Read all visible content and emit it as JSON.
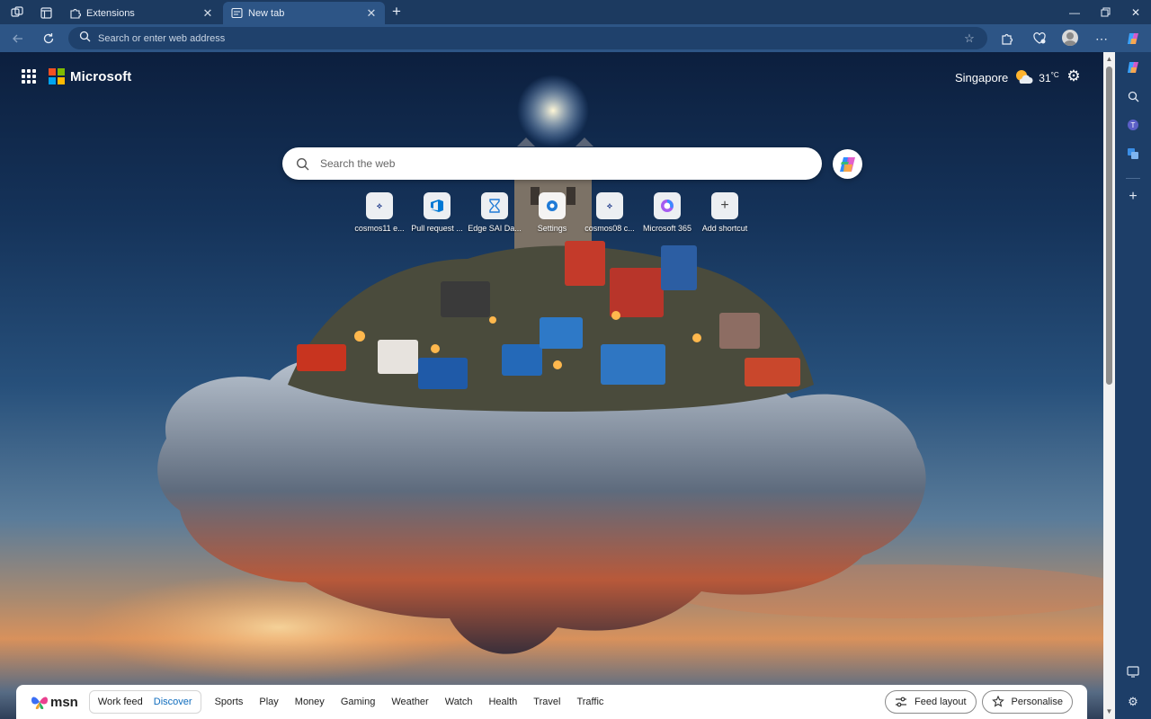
{
  "tabs": [
    {
      "label": "Extensions",
      "icon": "puzzle-icon"
    },
    {
      "label": "New tab",
      "icon": "newtab-icon"
    }
  ],
  "address_bar": {
    "placeholder": "Search or enter web address"
  },
  "page": {
    "brand": "Microsoft",
    "weather": {
      "city": "Singapore",
      "temperature": "31",
      "unit": "°C"
    },
    "search": {
      "placeholder": "Search the web"
    },
    "shortcuts": [
      {
        "label": "cosmos11 e...",
        "icon": "cosmos-icon",
        "abbr": "⟡"
      },
      {
        "label": "Pull request ...",
        "icon": "azure-devops-icon",
        "abbr": ""
      },
      {
        "label": "Edge SAI Da...",
        "icon": "hourglass-icon",
        "abbr": "⧖"
      },
      {
        "label": "Settings",
        "icon": "settings-dot-icon",
        "abbr": ""
      },
      {
        "label": "cosmos08 c...",
        "icon": "cosmos-icon",
        "abbr": "⟡"
      },
      {
        "label": "Microsoft 365",
        "icon": "m365-icon",
        "abbr": ""
      },
      {
        "label": "Add shortcut",
        "icon": "plus-icon",
        "abbr": "+"
      }
    ]
  },
  "msn": {
    "logo": "msn",
    "feed_tabs": [
      "Work feed",
      "Discover"
    ],
    "selected_feed": "Discover",
    "nav": [
      "Sports",
      "Play",
      "Money",
      "Gaming",
      "Weather",
      "Watch",
      "Health",
      "Travel",
      "Traffic"
    ],
    "feed_layout": "Feed layout",
    "personalise": "Personalise"
  },
  "colors": {
    "accent": "#0f6cbd",
    "titlebar": "#1c3a60",
    "toolbar": "#2d5586"
  }
}
